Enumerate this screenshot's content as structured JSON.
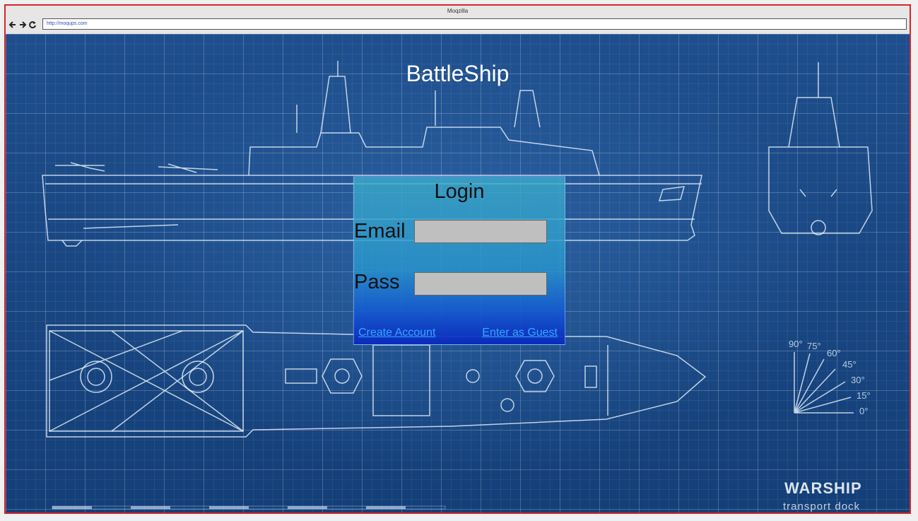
{
  "browser": {
    "window_title": "Moqzilla",
    "url": "http://moqups.com",
    "back_icon": "arrow-left-icon",
    "forward_icon": "arrow-right-icon",
    "reload_icon": "reload-icon"
  },
  "page": {
    "title": "BattleShip",
    "background_caption_1": "WARSHIP",
    "background_caption_2": "transport dock",
    "angle_labels": [
      "90°",
      "75°",
      "60°",
      "45°",
      "30°",
      "15°",
      "0°"
    ]
  },
  "login": {
    "heading": "Login",
    "email_label": "Email",
    "email_value": "",
    "pass_label": "Pass",
    "pass_value": "",
    "create_account_link": "Create Account",
    "guest_link": "Enter as Guest"
  },
  "colors": {
    "frame_border": "#d8262c",
    "link": "#33a9ff",
    "input_fill": "#bfbfbf"
  }
}
